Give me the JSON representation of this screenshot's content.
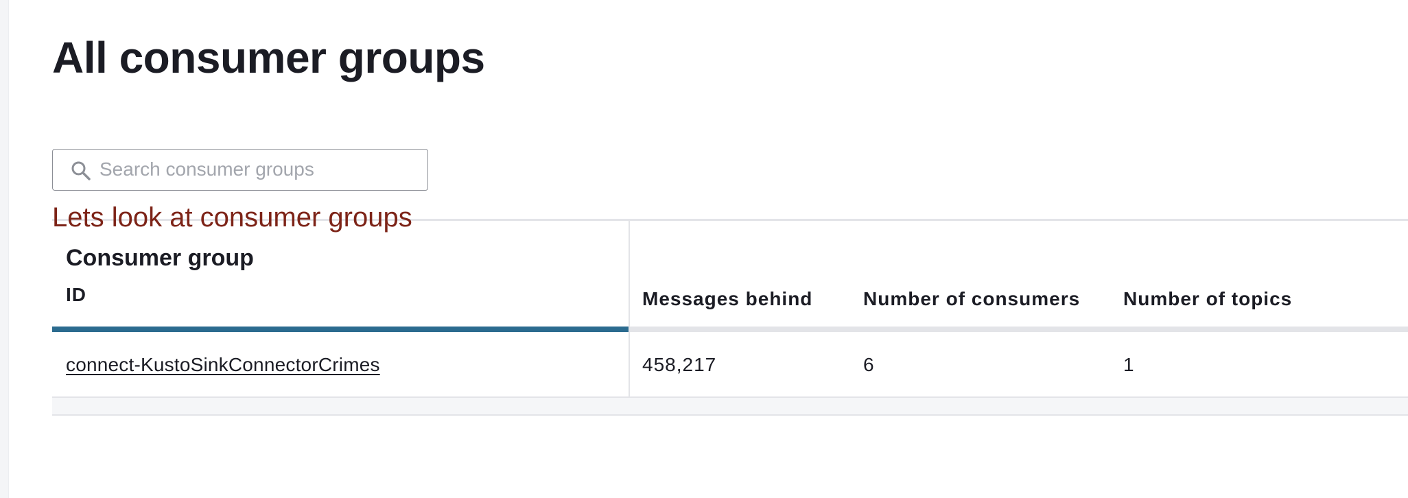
{
  "page": {
    "title": "All consumer groups"
  },
  "search": {
    "placeholder": "Search consumer groups",
    "value": "",
    "icon": "search-icon"
  },
  "annotation": {
    "text": "Lets look at consumer groups",
    "color": "#7d2418"
  },
  "table": {
    "group_header": "Consumer group",
    "columns": [
      "ID",
      "Messages behind",
      "Number of consumers",
      "Number of topics"
    ],
    "rows": [
      {
        "id": "connect-KustoSinkConnectorCrimes",
        "messages_behind": "458,217",
        "consumers": "6",
        "topics": "1"
      }
    ]
  },
  "colors": {
    "active_sort_bar": "#2b6b8f",
    "header_bar": "#e3e4e8",
    "text": "#1b1c24"
  }
}
